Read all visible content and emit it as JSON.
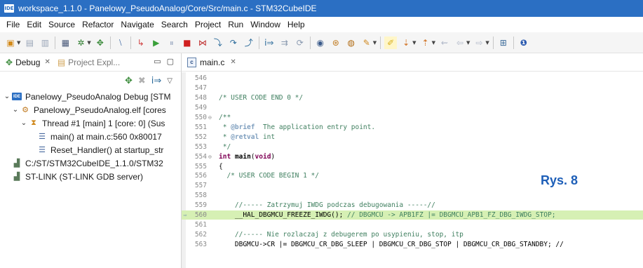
{
  "window": {
    "app_icon_label": "IDE",
    "title": "workspace_1.1.0 - Panelowy_PseudoAnalog/Core/Src/main.c - STM32CubeIDE"
  },
  "menu": [
    "File",
    "Edit",
    "Source",
    "Refactor",
    "Navigate",
    "Search",
    "Project",
    "Run",
    "Window",
    "Help"
  ],
  "left_panel": {
    "tabs": [
      {
        "label": "Debug",
        "icon": "debug-bug-icon"
      },
      {
        "label": "Project Expl...",
        "icon": "project-explorer-icon"
      }
    ],
    "tree": [
      {
        "label": "Panelowy_PseudoAnalog Debug [STM",
        "icon": "ide-launch-icon",
        "indent": 0,
        "expanded": true
      },
      {
        "label": "Panelowy_PseudoAnalog.elf [cores",
        "icon": "elf-process-icon",
        "indent": 1,
        "expanded": true
      },
      {
        "label": "Thread #1 [main] 1 [core: 0] (Sus",
        "icon": "thread-suspended-icon",
        "indent": 2,
        "expanded": true
      },
      {
        "label": "main() at main.c:560 0x80017",
        "icon": "stack-frame-icon",
        "indent": 3,
        "expanded": null
      },
      {
        "label": "Reset_Handler() at startup_str",
        "icon": "stack-frame-icon",
        "indent": 3,
        "expanded": null
      },
      {
        "label": "C:/ST/STM32CubeIDE_1.1.0/STM32",
        "icon": "gdb-process-icon",
        "indent": 1,
        "expanded": null
      },
      {
        "label": "ST-LINK (ST-LINK GDB server)",
        "icon": "gdb-process-icon",
        "indent": 1,
        "expanded": null
      }
    ]
  },
  "editor": {
    "tab_label": "main.c",
    "tab_icon_label": "c",
    "current_line": 560,
    "annotation": "Rys. 8",
    "lines": [
      {
        "n": "546",
        "parts": []
      },
      {
        "n": "547",
        "parts": []
      },
      {
        "n": "548",
        "parts": [
          {
            "t": "/* USER CODE END 0 */",
            "c": "cm"
          }
        ]
      },
      {
        "n": "549",
        "parts": []
      },
      {
        "n": "550",
        "fold": "⊖",
        "parts": [
          {
            "t": "/**",
            "c": "cm"
          }
        ]
      },
      {
        "n": "551",
        "parts": [
          {
            "t": " * ",
            "c": "cm"
          },
          {
            "t": "@brief",
            "c": "tag"
          },
          {
            "t": "  The application entry point.",
            "c": "cm"
          }
        ]
      },
      {
        "n": "552",
        "parts": [
          {
            "t": " * ",
            "c": "cm"
          },
          {
            "t": "@retval",
            "c": "tag"
          },
          {
            "t": " int",
            "c": "cm"
          }
        ]
      },
      {
        "n": "553",
        "parts": [
          {
            "t": " */",
            "c": "cm"
          }
        ]
      },
      {
        "n": "554",
        "fold": "⊖",
        "parts": [
          {
            "t": "int",
            "c": "kw"
          },
          {
            "t": " ",
            "c": "plain"
          },
          {
            "t": "main",
            "c": "fn"
          },
          {
            "t": "(",
            "c": "plain"
          },
          {
            "t": "void",
            "c": "kw"
          },
          {
            "t": ")",
            "c": "plain"
          }
        ]
      },
      {
        "n": "555",
        "parts": [
          {
            "t": "{",
            "c": "plain"
          }
        ]
      },
      {
        "n": "556",
        "parts": [
          {
            "t": "  /* USER CODE BEGIN 1 */",
            "c": "cm"
          }
        ]
      },
      {
        "n": "557",
        "parts": []
      },
      {
        "n": "558",
        "parts": []
      },
      {
        "n": "559",
        "parts": [
          {
            "t": "    //----- Zatrzymuj IWDG podczas debugowania -----//",
            "c": "cm"
          }
        ]
      },
      {
        "n": "560",
        "marker": "⇨",
        "parts": [
          {
            "t": "    __HAL_DBGMCU_FREEZE_IWDG(); ",
            "c": "plain"
          },
          {
            "t": "// DBGMCU -> APB1FZ |= DBGMCU_APB1_FZ_DBG_IWDG_STOP;",
            "c": "cm"
          }
        ]
      },
      {
        "n": "561",
        "parts": []
      },
      {
        "n": "562",
        "parts": [
          {
            "t": "    //----- Nie rozlaczaj z debugerem po usypieniu, stop, itp",
            "c": "cm"
          }
        ]
      },
      {
        "n": "563",
        "parts": [
          {
            "t": "    DBGMCU->CR |= DBGMCU_CR_DBG_SLEEP | DBGMCU_CR_DBG_STOP | DBGMCU_CR_DBG_STANDBY; //",
            "c": "plain"
          }
        ]
      }
    ]
  }
}
